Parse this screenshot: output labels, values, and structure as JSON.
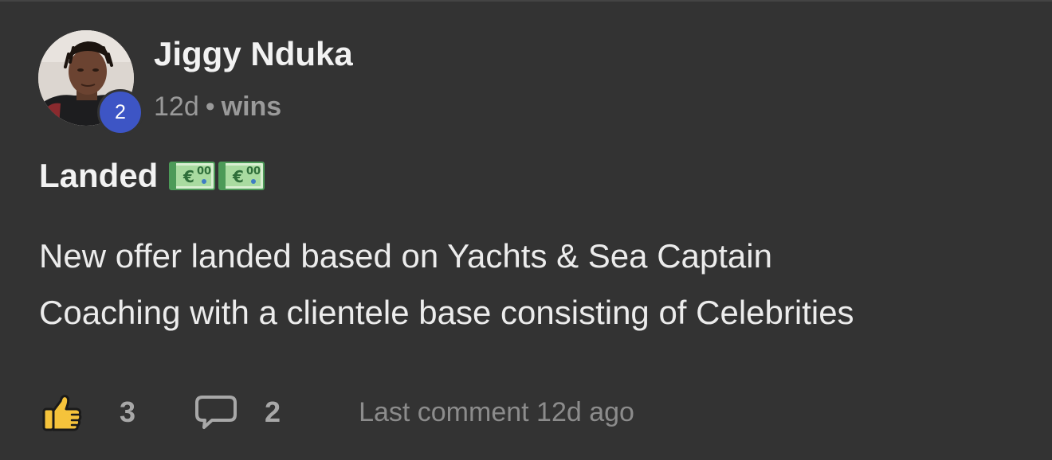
{
  "post": {
    "author": {
      "name": "Jiggy Nduka",
      "level": "2"
    },
    "meta": {
      "age": "12d",
      "separator": "•",
      "category": "wins"
    },
    "title": "Landed",
    "title_emoji": [
      "money-with-wings-euro-icon",
      "money-with-wings-euro-icon"
    ],
    "body_lines": [
      "New offer landed based on Yachts & Sea Captain",
      "Coaching with a clientele base consisting of Celebrities"
    ],
    "footer": {
      "like_icon": "thumbs-up-icon",
      "like_count": "3",
      "comment_icon": "comment-bubble-icon",
      "comment_count": "2",
      "last_comment": "Last comment 12d ago"
    }
  },
  "colors": {
    "background": "#333333",
    "badge": "#3d55c5",
    "text_primary": "#f2f2f2",
    "text_muted": "#9a9a9a",
    "like_yellow": "#f5c33b"
  }
}
